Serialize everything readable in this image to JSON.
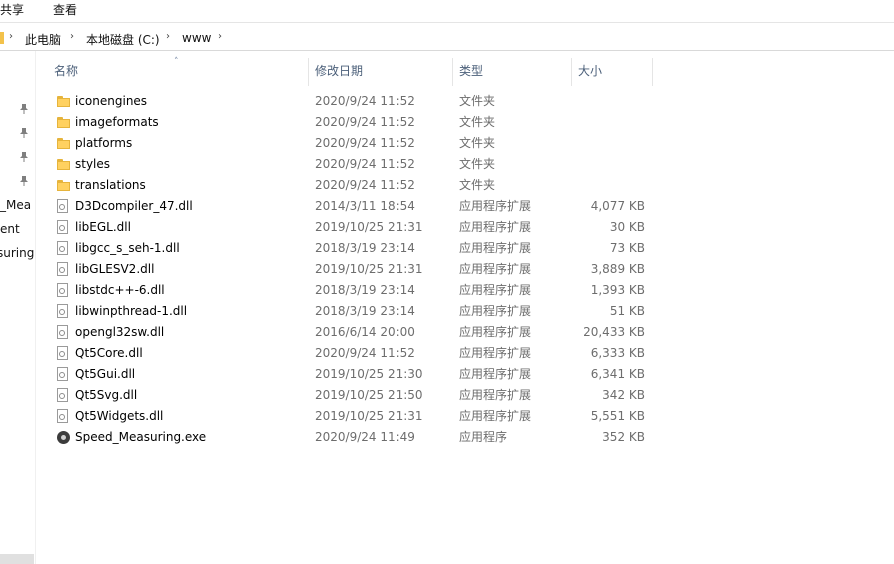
{
  "ribbon": {
    "tabs": [
      "共享",
      "查看"
    ]
  },
  "address": {
    "segments": [
      "此电脑",
      "本地磁盘 (C:)",
      "www"
    ]
  },
  "nav": {
    "items": [
      "_Mea",
      "ent",
      "suring"
    ]
  },
  "columns": {
    "name": "名称",
    "date": "修改日期",
    "type": "类型",
    "size": "大小"
  },
  "files": [
    {
      "name": "iconengines",
      "date": "2020/9/24 11:52",
      "type": "文件夹",
      "size": "",
      "icon": "folder-icon"
    },
    {
      "name": "imageformats",
      "date": "2020/9/24 11:52",
      "type": "文件夹",
      "size": "",
      "icon": "folder-icon"
    },
    {
      "name": "platforms",
      "date": "2020/9/24 11:52",
      "type": "文件夹",
      "size": "",
      "icon": "folder-icon"
    },
    {
      "name": "styles",
      "date": "2020/9/24 11:52",
      "type": "文件夹",
      "size": "",
      "icon": "folder-icon"
    },
    {
      "name": "translations",
      "date": "2020/9/24 11:52",
      "type": "文件夹",
      "size": "",
      "icon": "folder-icon"
    },
    {
      "name": "D3Dcompiler_47.dll",
      "date": "2014/3/11 18:54",
      "type": "应用程序扩展",
      "size": "4,077 KB",
      "icon": "dll-icon"
    },
    {
      "name": "libEGL.dll",
      "date": "2019/10/25 21:31",
      "type": "应用程序扩展",
      "size": "30 KB",
      "icon": "dll-icon"
    },
    {
      "name": "libgcc_s_seh-1.dll",
      "date": "2018/3/19 23:14",
      "type": "应用程序扩展",
      "size": "73 KB",
      "icon": "dll-icon"
    },
    {
      "name": "libGLESV2.dll",
      "date": "2019/10/25 21:31",
      "type": "应用程序扩展",
      "size": "3,889 KB",
      "icon": "dll-icon"
    },
    {
      "name": "libstdc++-6.dll",
      "date": "2018/3/19 23:14",
      "type": "应用程序扩展",
      "size": "1,393 KB",
      "icon": "dll-icon"
    },
    {
      "name": "libwinpthread-1.dll",
      "date": "2018/3/19 23:14",
      "type": "应用程序扩展",
      "size": "51 KB",
      "icon": "dll-icon"
    },
    {
      "name": "opengl32sw.dll",
      "date": "2016/6/14 20:00",
      "type": "应用程序扩展",
      "size": "20,433 KB",
      "icon": "dll-icon"
    },
    {
      "name": "Qt5Core.dll",
      "date": "2020/9/24 11:52",
      "type": "应用程序扩展",
      "size": "6,333 KB",
      "icon": "dll-icon"
    },
    {
      "name": "Qt5Gui.dll",
      "date": "2019/10/25 21:30",
      "type": "应用程序扩展",
      "size": "6,341 KB",
      "icon": "dll-icon"
    },
    {
      "name": "Qt5Svg.dll",
      "date": "2019/10/25 21:50",
      "type": "应用程序扩展",
      "size": "342 KB",
      "icon": "dll-icon"
    },
    {
      "name": "Qt5Widgets.dll",
      "date": "2019/10/25 21:31",
      "type": "应用程序扩展",
      "size": "5,551 KB",
      "icon": "dll-icon"
    },
    {
      "name": "Speed_Measuring.exe",
      "date": "2020/9/24 11:49",
      "type": "应用程序",
      "size": "352 KB",
      "icon": "exe-icon"
    }
  ]
}
